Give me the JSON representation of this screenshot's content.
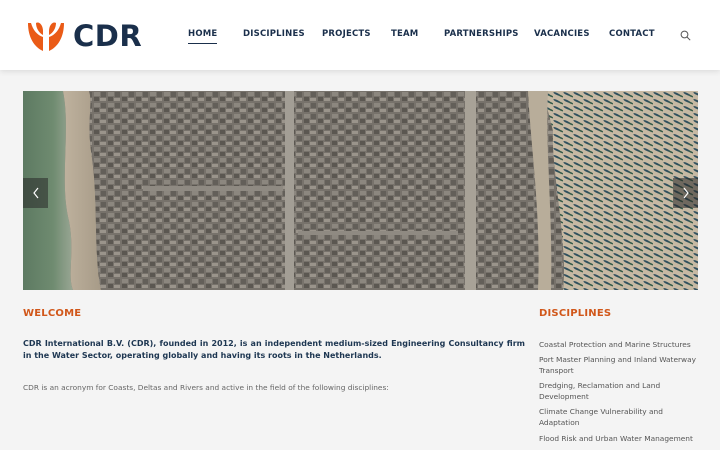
{
  "brand": {
    "name": "CDR",
    "accent": "#ea5b17",
    "navy": "#1a2f4b"
  },
  "nav": {
    "items": [
      {
        "label": "HOME",
        "active": true
      },
      {
        "label": "DISCIPLINES",
        "active": false
      },
      {
        "label": "PROJECTS",
        "active": false
      },
      {
        "label": "TEAM",
        "active": false
      },
      {
        "label": "PARTNERSHIPS",
        "active": false
      },
      {
        "label": "VACANCIES",
        "active": false
      },
      {
        "label": "CONTACT",
        "active": false
      }
    ],
    "search_icon": "search-icon"
  },
  "slider": {
    "prev_icon": "chevron-left-icon",
    "next_icon": "chevron-right-icon"
  },
  "welcome": {
    "title": "WELCOME",
    "intro": "CDR International B.V. (CDR), founded in 2012, is an independent medium-sized Engineering Consultancy firm in the Water Sector, operating globally and having its roots in the Netherlands.",
    "description": "CDR is an acronym for Coasts, Deltas and Rivers and active in the field of the following disciplines:"
  },
  "disciplines": {
    "title": "DISCIPLINES",
    "items": [
      "Coastal Protection and Marine Structures",
      "Port Master Planning and Inland Waterway Transport",
      "Dredging, Reclamation and Land Development",
      "Climate Change Vulnerability and Adaptation",
      "Flood Risk and Urban Water Management"
    ]
  }
}
